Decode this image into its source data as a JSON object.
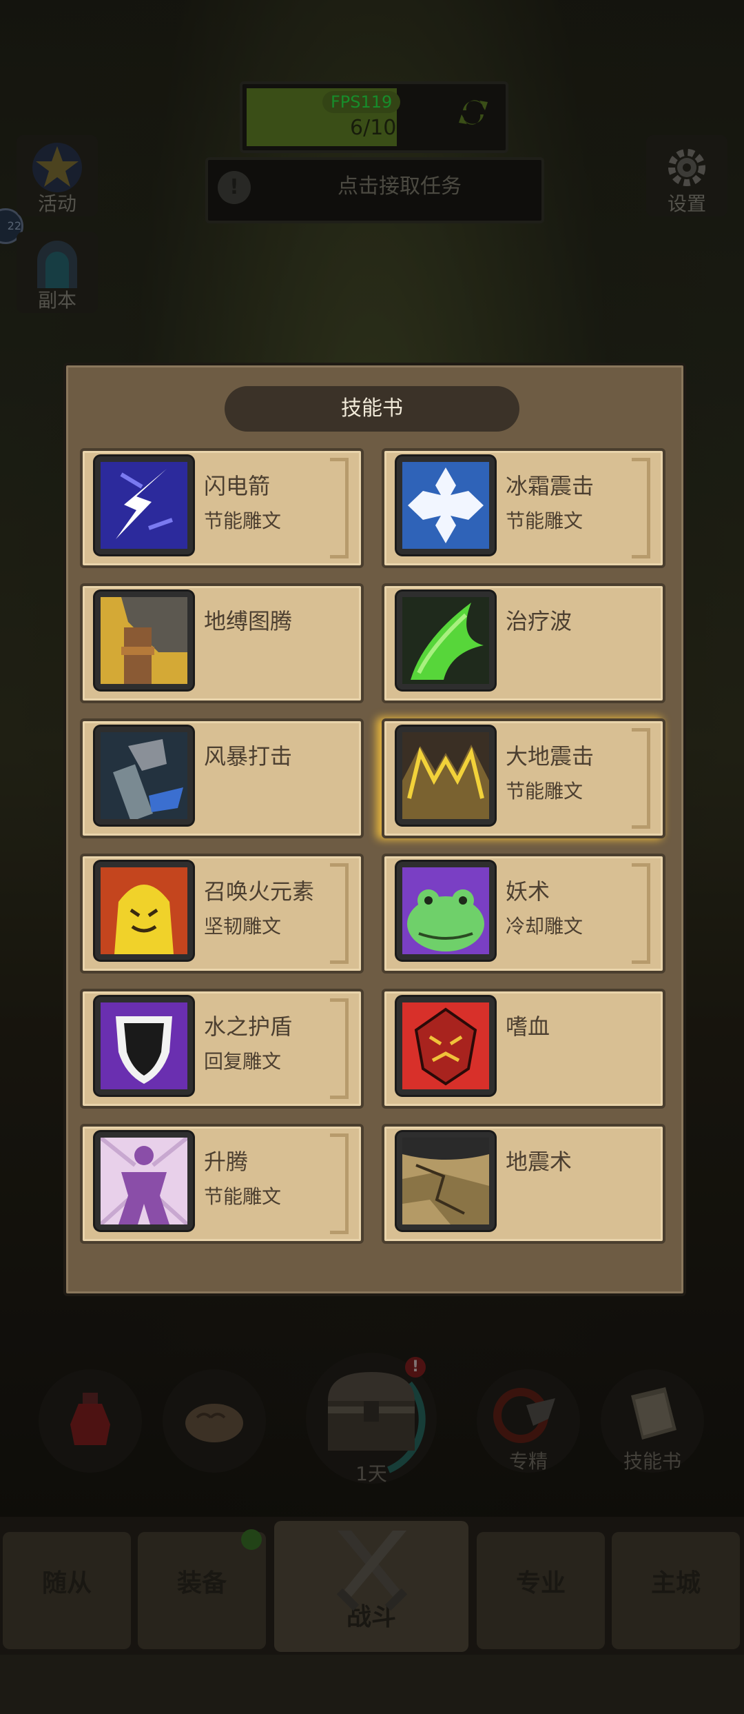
{
  "hud": {
    "fps": "FPS119",
    "quest_count": "6/10",
    "task_prompt": "点击接取任务",
    "left_buttons": [
      {
        "label": "活动",
        "icon": "star-icon"
      },
      {
        "label": "副本",
        "icon": "gate-icon"
      }
    ],
    "settings_label": "设置",
    "edge_badge": "22"
  },
  "modal": {
    "title": "技能书",
    "skills": [
      {
        "name": "闪电箭",
        "rune": "节能雕文",
        "icon": "lightning-bolt-icon"
      },
      {
        "name": "冰霜震击",
        "rune": "节能雕文",
        "icon": "frost-shock-icon"
      },
      {
        "name": "地缚图腾",
        "rune": "",
        "icon": "earthbind-totem-icon"
      },
      {
        "name": "治疗波",
        "rune": "",
        "icon": "healing-wave-icon"
      },
      {
        "name": "风暴打击",
        "rune": "",
        "icon": "stormstrike-icon"
      },
      {
        "name": "大地震击",
        "rune": "节能雕文",
        "icon": "earth-shock-icon"
      },
      {
        "name": "召唤火元素",
        "rune": "坚韧雕文",
        "icon": "fire-elemental-icon"
      },
      {
        "name": "妖术",
        "rune": "冷却雕文",
        "icon": "hex-frog-icon"
      },
      {
        "name": "水之护盾",
        "rune": "回复雕文",
        "icon": "water-shield-icon"
      },
      {
        "name": "嗜血",
        "rune": "",
        "icon": "bloodlust-icon"
      },
      {
        "name": "升腾",
        "rune": "节能雕文",
        "icon": "ascendance-icon"
      },
      {
        "name": "地震术",
        "rune": "",
        "icon": "earthquake-icon"
      }
    ]
  },
  "bottom": {
    "round_buttons": [
      {
        "label": "",
        "icon": "potion-icon"
      },
      {
        "label": "",
        "icon": "bread-icon"
      },
      {
        "label": "1天",
        "icon": "treasure-chest-icon"
      },
      {
        "label": "专精",
        "icon": "specialization-icon"
      },
      {
        "label": "技能书",
        "icon": "skill-book-icon"
      }
    ],
    "tabs": [
      "随从",
      "装备",
      "战斗",
      "专业",
      "主城"
    ]
  },
  "colors": {
    "modal_bg": "#6e5c44",
    "card_bg": "#d8bf93",
    "title_pill": "#3b3228",
    "fps_green": "#2bff4f"
  }
}
